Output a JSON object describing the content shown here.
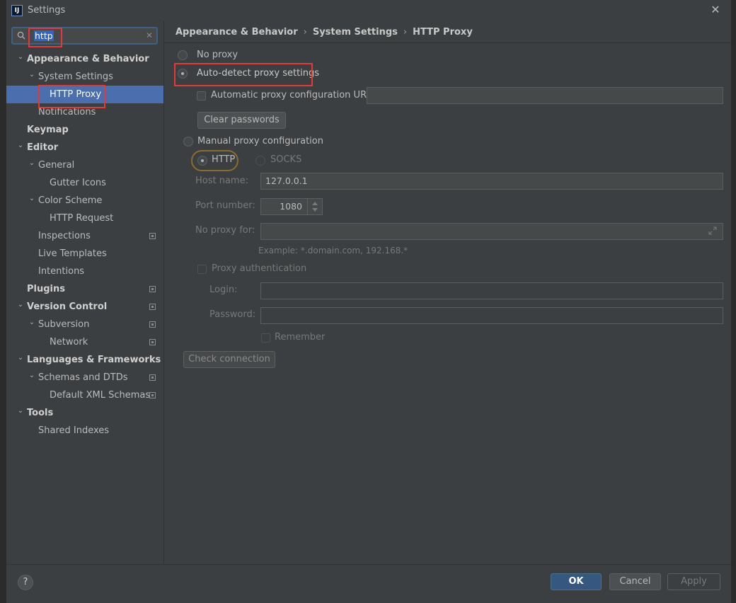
{
  "window": {
    "title": "Settings",
    "close_symbol": "✕",
    "app_icon_text": "IJ"
  },
  "search": {
    "value": "http",
    "clear_symbol": "✕"
  },
  "tree": [
    {
      "label": "Appearance & Behavior",
      "bold": true,
      "expanded": true,
      "level": 0
    },
    {
      "label": "System Settings",
      "bold": false,
      "expanded": true,
      "level": 1
    },
    {
      "label": "HTTP Proxy",
      "bold": false,
      "level": 2,
      "selected": true
    },
    {
      "label": "Notifications",
      "bold": false,
      "level": 1
    },
    {
      "label": "Keymap",
      "bold": true,
      "level": 0
    },
    {
      "label": "Editor",
      "bold": true,
      "expanded": true,
      "level": 0
    },
    {
      "label": "General",
      "bold": false,
      "expanded": true,
      "level": 1
    },
    {
      "label": "Gutter Icons",
      "bold": false,
      "level": 2
    },
    {
      "label": "Color Scheme",
      "bold": false,
      "expanded": true,
      "level": 1
    },
    {
      "label": "HTTP Request",
      "bold": false,
      "level": 2
    },
    {
      "label": "Inspections",
      "bold": false,
      "level": 1,
      "project_icon": true
    },
    {
      "label": "Live Templates",
      "bold": false,
      "level": 1
    },
    {
      "label": "Intentions",
      "bold": false,
      "level": 1
    },
    {
      "label": "Plugins",
      "bold": true,
      "level": 0,
      "project_icon": true
    },
    {
      "label": "Version Control",
      "bold": true,
      "expanded": true,
      "level": 0,
      "project_icon": true
    },
    {
      "label": "Subversion",
      "bold": false,
      "expanded": true,
      "level": 1,
      "project_icon": true
    },
    {
      "label": "Network",
      "bold": false,
      "level": 2,
      "project_icon": true
    },
    {
      "label": "Languages & Frameworks",
      "bold": true,
      "expanded": true,
      "level": 0
    },
    {
      "label": "Schemas and DTDs",
      "bold": false,
      "expanded": true,
      "level": 1,
      "project_icon": true
    },
    {
      "label": "Default XML Schemas",
      "bold": false,
      "level": 2,
      "project_icon": true
    },
    {
      "label": "Tools",
      "bold": true,
      "expanded": true,
      "level": 0
    },
    {
      "label": "Shared Indexes",
      "bold": false,
      "level": 1
    }
  ],
  "breadcrumb": {
    "items": [
      "Appearance & Behavior",
      "System Settings",
      "HTTP Proxy"
    ],
    "separator": "›"
  },
  "proxy": {
    "no_proxy_label": "No proxy",
    "auto_detect_label": "Auto-detect proxy settings",
    "auto_config_url_label": "Automatic proxy configuration URL:",
    "auto_config_url_value": "",
    "clear_passwords_label": "Clear passwords",
    "manual_label": "Manual proxy configuration",
    "http_label": "HTTP",
    "socks_label": "SOCKS",
    "host_name_label": "Host name:",
    "host_name_value": "127.0.0.1",
    "port_number_label": "Port number:",
    "port_number_value": "1080",
    "no_proxy_for_label": "No proxy for:",
    "no_proxy_for_value": "",
    "example_text": "Example: *.domain.com, 192.168.*",
    "proxy_auth_label": "Proxy authentication",
    "login_label": "Login:",
    "login_value": "",
    "password_label": "Password:",
    "password_value": "",
    "remember_label": "Remember",
    "check_connection_label": "Check connection"
  },
  "footer": {
    "help_symbol": "?",
    "ok_label": "OK",
    "cancel_label": "Cancel",
    "apply_label": "Apply"
  }
}
